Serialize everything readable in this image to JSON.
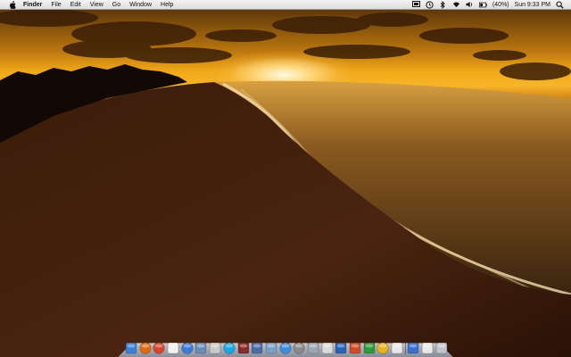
{
  "menubar": {
    "app_name": "Finder",
    "items": [
      "File",
      "Edit",
      "View",
      "Go",
      "Window",
      "Help"
    ],
    "status": {
      "battery": "(40%)",
      "clock": "Sun 9:33 PM"
    },
    "status_icons": [
      "screen-share-icon",
      "time-machine-icon",
      "wifi-icon",
      "volume-icon",
      "battery-icon",
      "spotlight-icon"
    ]
  },
  "dock": {
    "apps": [
      {
        "name": "finder",
        "color": "#3b7fd8"
      },
      {
        "name": "firefox",
        "color": "#e06a12"
      },
      {
        "name": "chrome",
        "color": "#d8442c"
      },
      {
        "name": "calendar",
        "color": "#f2f2f2"
      },
      {
        "name": "itunes",
        "color": "#3a7ad8"
      },
      {
        "name": "iphoto",
        "color": "#6b8cb8"
      },
      {
        "name": "preview",
        "color": "#c9c9c9"
      },
      {
        "name": "skype",
        "color": "#19a8e6"
      },
      {
        "name": "photo-booth",
        "color": "#8a2b2b"
      },
      {
        "name": "screen-sharing",
        "color": "#4a6aa8"
      },
      {
        "name": "activity-monitor",
        "color": "#7aa0c8"
      },
      {
        "name": "app-store",
        "color": "#3d8ee0"
      },
      {
        "name": "system-preferences",
        "color": "#8a8a8a"
      },
      {
        "name": "script-editor",
        "color": "#9aa6b2"
      },
      {
        "name": "adium",
        "color": "#d9d9d9"
      },
      {
        "name": "word",
        "color": "#2a62b8"
      },
      {
        "name": "powerpoint",
        "color": "#d04a22"
      },
      {
        "name": "excel",
        "color": "#2f9a3a"
      },
      {
        "name": "outlook",
        "color": "#e6b41a"
      },
      {
        "name": "textedit",
        "color": "#e8e8e8"
      },
      {
        "name": "downloads-stack",
        "color": "#3a6fd0"
      },
      {
        "name": "documents-stack",
        "color": "#e8e8e8"
      },
      {
        "name": "trash",
        "color": "#bfc4ca"
      }
    ]
  }
}
